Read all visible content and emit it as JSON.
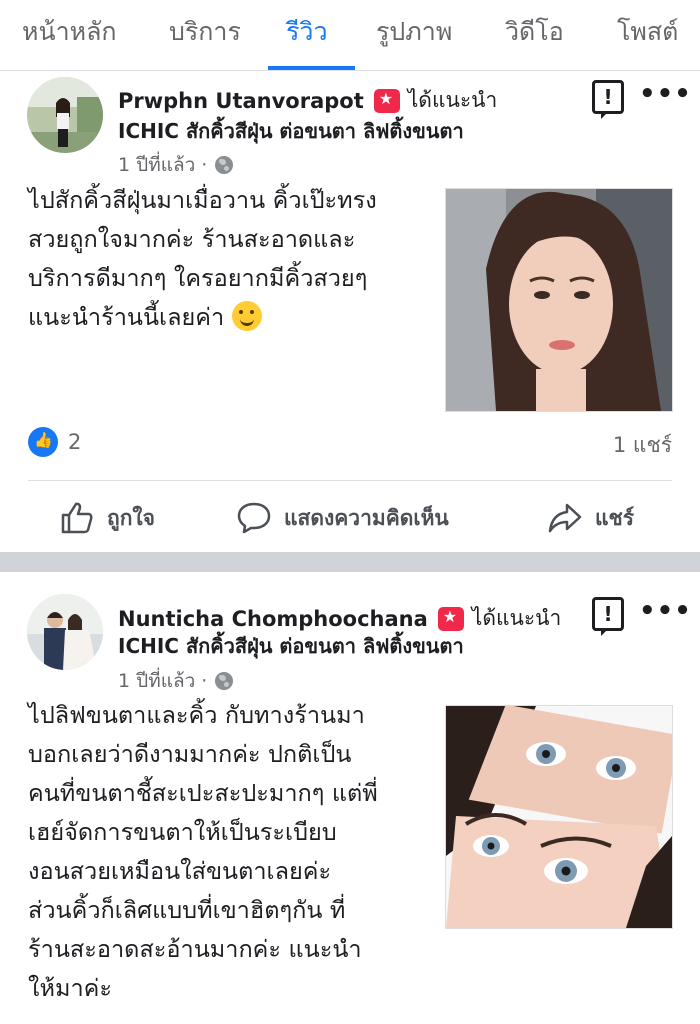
{
  "tabs": [
    {
      "label": "หน้าหลัก",
      "active": false
    },
    {
      "label": "บริการ",
      "active": false
    },
    {
      "label": "รีวิว",
      "active": true
    },
    {
      "label": "รูปภาพ",
      "active": false
    },
    {
      "label": "วิดีโอ",
      "active": false
    },
    {
      "label": "โพสต์",
      "active": false
    }
  ],
  "posts": [
    {
      "author": "Prwphn Utanvorapot",
      "recommends": "ได้แนะนำ",
      "page": "ICHIC สักคิ้วสีฝุ่น ต่อขนตา ลิฟติ้งขนตา",
      "time": "1 ปีที่แล้ว ·",
      "text": "ไปสักคิ้วสีฝุ่นมาเมื่อวาน คิ้วเป๊ะทรง\nสวยถูกใจมากค่ะ ร้านสะอาดและ\nบริการดีมากๆ ใครอยากมีคิ้วสวยๆ\nแนะนำร้านนี้เลยค่า",
      "likes": "2",
      "shares": "1 แชร์",
      "actions": {
        "like": "ถูกใจ",
        "comment": "แสดงความคิดเห็น",
        "share": "แชร์"
      }
    },
    {
      "author": "Nunticha Chomphoochana",
      "recommends": "ได้แนะนำ",
      "page": "ICHIC สักคิ้วสีฝุ่น ต่อขนตา ลิฟติ้งขนตา",
      "time": "1 ปีที่แล้ว ·",
      "text": "ไปลิฟขนตาและคิ้ว กับทางร้านมา\nบอกเลยว่าดีงามมากค่ะ ปกติเป็น\nคนที่ขนตาชี้สะเปะสะปะมากๆ แต่พี่\nเฮย์จัดการขนตาให้เป็นระเบียบ\nงอนสวยเหมือนใส่ขนตาเลยค่ะ\nส่วนคิ้วก็เลิศแบบที่เขาฮิตๆกัน ที่\nร้านสะอาดสะอ้านมากค่ะ แนะนำ\nให้มาค่ะ"
    }
  ],
  "colors": {
    "accent": "#1877f2",
    "badge": "#f0284a"
  }
}
